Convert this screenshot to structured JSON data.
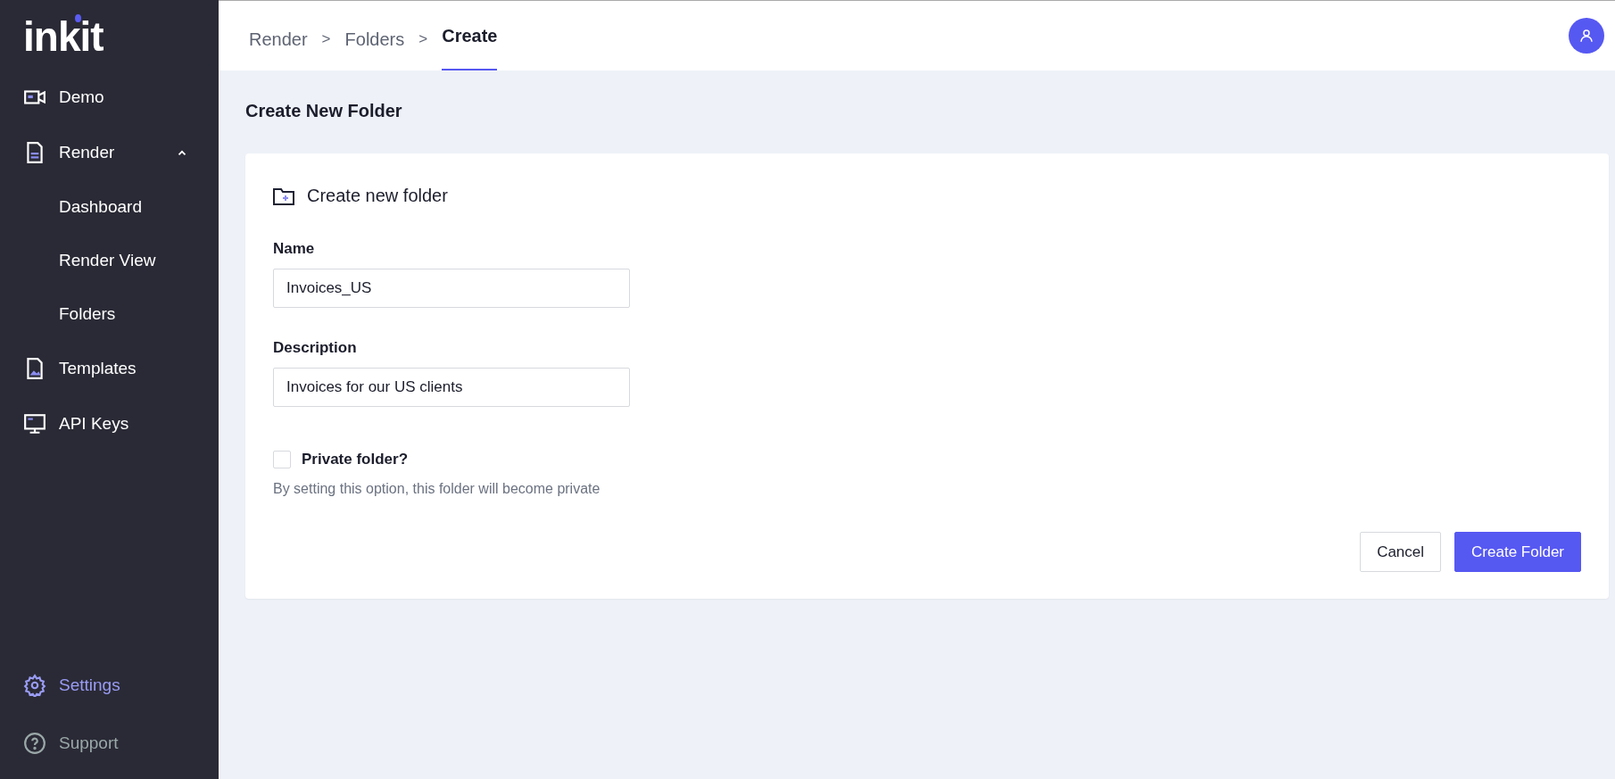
{
  "sidebar": {
    "logo": "inkit",
    "items": [
      {
        "label": "Demo",
        "kind": "video",
        "selected": false
      },
      {
        "label": "Render",
        "kind": "document",
        "selected": false,
        "expanded": true,
        "children": [
          {
            "label": "Dashboard",
            "selected": false
          },
          {
            "label": "Render View",
            "selected": false
          },
          {
            "label": "Folders",
            "selected": false
          }
        ]
      },
      {
        "label": "Templates",
        "kind": "image-file",
        "selected": false
      },
      {
        "label": "API Keys",
        "kind": "monitor",
        "selected": false
      }
    ],
    "footer_items": [
      {
        "label": "Settings",
        "kind": "gear",
        "selected": true
      },
      {
        "label": "Support",
        "kind": "help",
        "selected": false
      }
    ]
  },
  "breadcrumb": {
    "separator": ">",
    "items": [
      {
        "label": "Render",
        "selected": false
      },
      {
        "label": "Folders",
        "selected": false
      },
      {
        "label": "Create",
        "selected": true
      }
    ]
  },
  "page_title": "Create New Folder",
  "card": {
    "title": "Create new folder",
    "fields": [
      {
        "label": "Name",
        "value": "Invoices_US"
      },
      {
        "label": "Description",
        "value": "Invoices for our US clients"
      }
    ],
    "private_checkbox": {
      "label": "Private folder?",
      "checked": false,
      "hint": "By setting this option, this folder will become private"
    },
    "buttons": [
      {
        "label": "Cancel",
        "kind": "secondary"
      },
      {
        "label": "Create Folder",
        "kind": "primary"
      }
    ]
  }
}
